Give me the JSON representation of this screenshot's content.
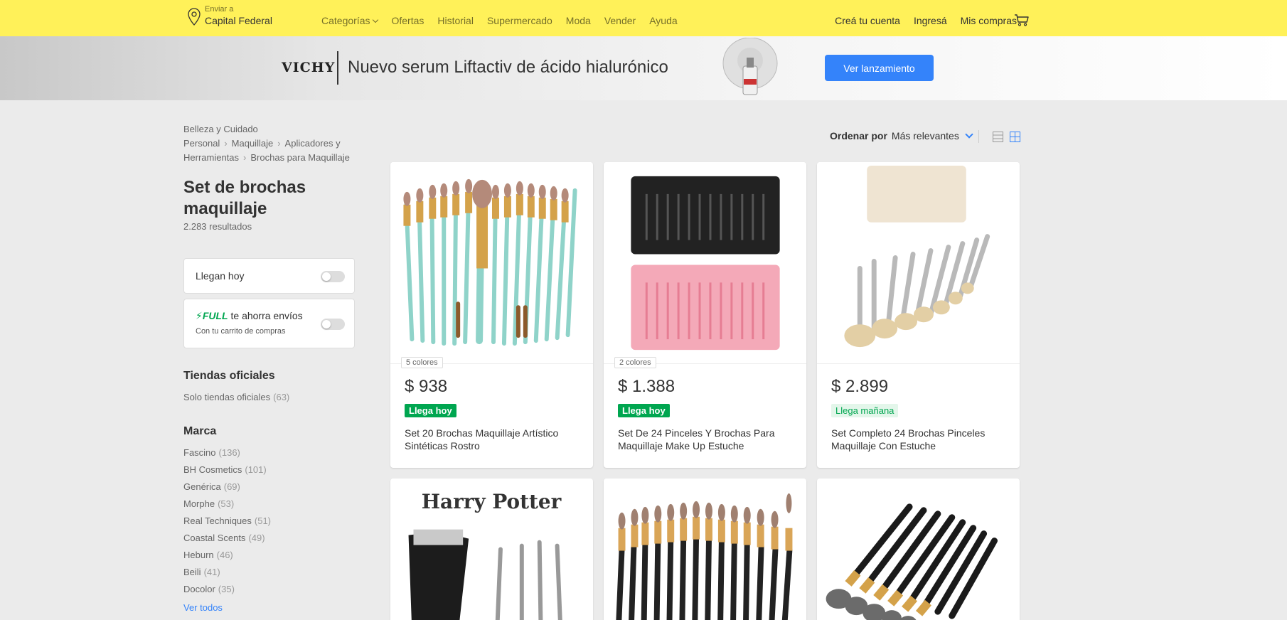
{
  "header": {
    "location_label": "Enviar a",
    "location_value": "Capital Federal",
    "nav": [
      "Categorías",
      "Ofertas",
      "Historial",
      "Supermercado",
      "Moda",
      "Vender",
      "Ayuda"
    ],
    "user_nav": [
      "Creá tu cuenta",
      "Ingresá",
      "Mis compras"
    ],
    "accent": "#fff159"
  },
  "banner": {
    "brand": "VICHY",
    "title": "Nuevo serum Liftactiv de ácido hialurónico",
    "button": "Ver lanzamiento"
  },
  "breadcrumb": [
    "Belleza y Cuidado Personal",
    "Maquillaje",
    "Aplicadores y Herramientas",
    "Brochas para Maquillaje"
  ],
  "page": {
    "title": "Set de brochas maquillaje",
    "results": "2.283 resultados"
  },
  "filters": {
    "today_label": "Llegan hoy",
    "full_logo": "FULL",
    "full_label": "te ahorra envíos",
    "full_sub": "Con tu carrito de compras"
  },
  "official": {
    "title": "Tiendas oficiales",
    "item_label": "Solo tiendas oficiales",
    "item_count": "(63)"
  },
  "brands": {
    "title": "Marca",
    "items": [
      {
        "name": "Fascino",
        "count": "(136)"
      },
      {
        "name": "BH Cosmetics",
        "count": "(101)"
      },
      {
        "name": "Genérica",
        "count": "(69)"
      },
      {
        "name": "Morphe",
        "count": "(53)"
      },
      {
        "name": "Real Techniques",
        "count": "(51)"
      },
      {
        "name": "Coastal Scents",
        "count": "(49)"
      },
      {
        "name": "Heburn",
        "count": "(46)"
      },
      {
        "name": "Beili",
        "count": "(41)"
      },
      {
        "name": "Docolor",
        "count": "(35)"
      }
    ],
    "see_all": "Ver todos"
  },
  "sort": {
    "label": "Ordenar por",
    "value": "Más relevantes"
  },
  "products": [
    {
      "colors": "5 colores",
      "price": "$ 938",
      "badge": "Llega hoy",
      "title": "Set 20 Brochas Maquillaje Artístico Sintéticas Rostro"
    },
    {
      "colors": "2 colores",
      "price": "$ 1.388",
      "badge": "Llega hoy",
      "title": "Set De 24 Pinceles Y Brochas Para Maquillaje Make Up Estuche"
    },
    {
      "colors": "",
      "price": "$ 2.899",
      "badge": "Llega mañana",
      "title": "Set Completo 24 Brochas Pinceles Maquillaje Con Estuche"
    }
  ],
  "products_row2": {
    "harry_text": "Harry Potter"
  }
}
